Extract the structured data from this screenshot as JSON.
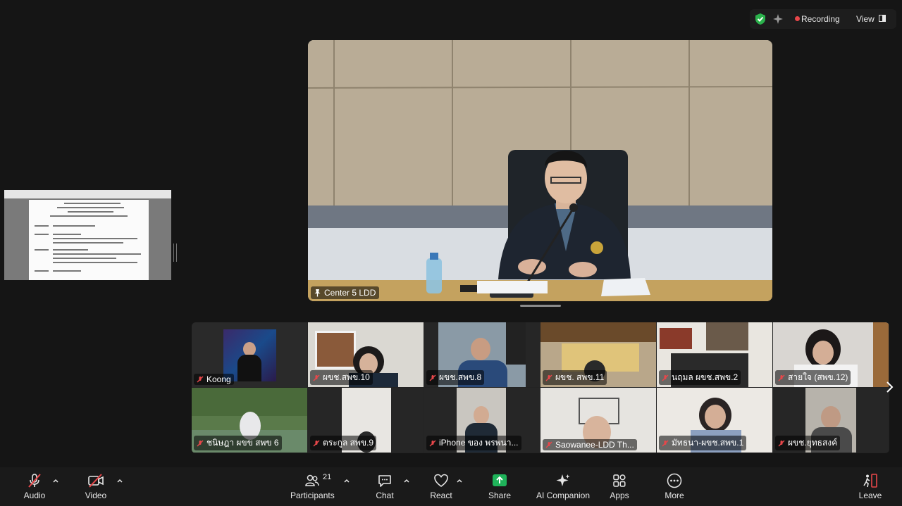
{
  "status": {
    "recording_label": "Recording",
    "view_label": "View"
  },
  "speaker": {
    "name": "Center 5 LDD"
  },
  "gallery": {
    "tiles": [
      {
        "name": "Koong"
      },
      {
        "name": "ผขช.สพข.10"
      },
      {
        "name": "ผขช.สพข.8"
      },
      {
        "name": "ผขช. สพข.11"
      },
      {
        "name": "นฤมล ผขช.สพข.2"
      },
      {
        "name": "สายใจ (สพข.12)"
      },
      {
        "name": "ชนิษฎา ผขข สพข 6"
      },
      {
        "name": "ตระกูล สพข.9"
      },
      {
        "name": "iPhone ของ พรพนา..."
      },
      {
        "name": "Saowanee-LDD Th..."
      },
      {
        "name": "มัทธนา-ผขช.สพข.1"
      },
      {
        "name": "ผขช.ยุทธสงค์"
      }
    ]
  },
  "toolbar": {
    "audio": "Audio",
    "video": "Video",
    "participants": "Participants",
    "participant_count": "21",
    "chat": "Chat",
    "react": "React",
    "share": "Share",
    "ai_companion": "AI Companion",
    "apps": "Apps",
    "more": "More",
    "leave": "Leave"
  },
  "colors": {
    "share_green": "#1fb35a",
    "recording_red": "#e8474a",
    "muted_red": "#e8474a",
    "shield_green": "#2bb24c"
  }
}
